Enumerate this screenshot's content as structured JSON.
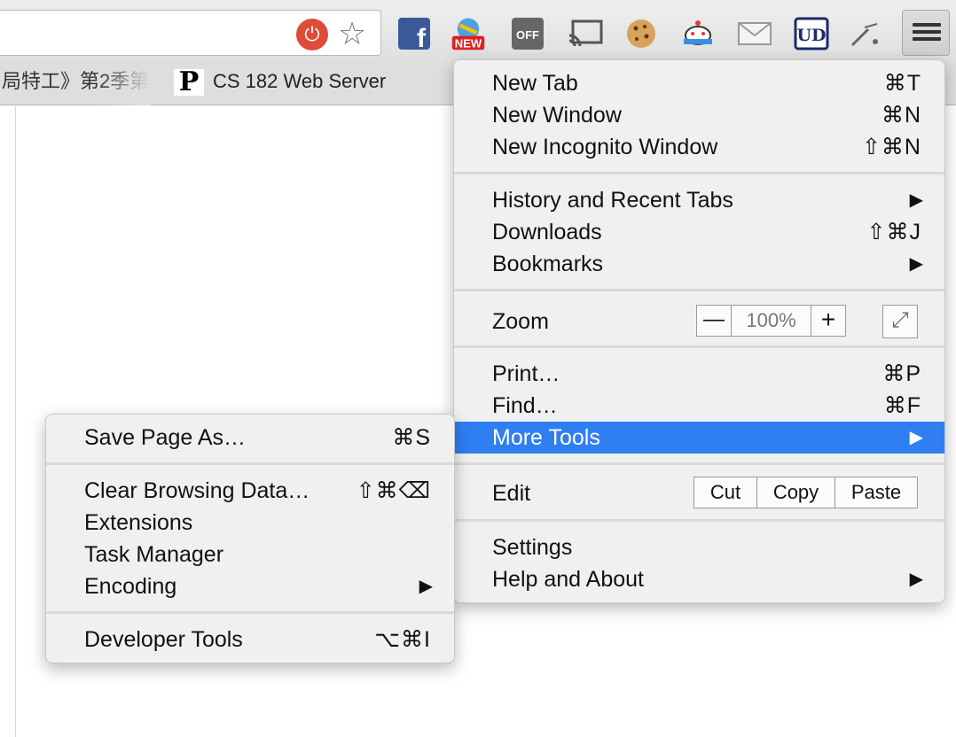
{
  "toolbar": {
    "extensions": [
      "plug-blocked-icon",
      "star-bookmark-icon",
      "facebook-icon",
      "new-extension-icon",
      "off-switch-icon",
      "cast-icon",
      "cookie-icon",
      "pixel-mascot-icon",
      "mail-icon",
      "ud-icon",
      "wand-icon",
      "hamburger-menu-icon"
    ],
    "new_badge": "NEW",
    "off_label": "OFF",
    "ud_label": "UD"
  },
  "bookmarks": {
    "item1": "局特工》第2季第",
    "item2": "CS 182 Web Server",
    "item2_icon_letter": "P"
  },
  "menu": {
    "new_tab": {
      "label": "New Tab",
      "shortcut": "⌘T"
    },
    "new_window": {
      "label": "New Window",
      "shortcut": "⌘N"
    },
    "new_incognito": {
      "label": "New Incognito Window",
      "shortcut": "⇧⌘N"
    },
    "history": {
      "label": "History and Recent Tabs",
      "arrow": "▶"
    },
    "downloads": {
      "label": "Downloads",
      "shortcut": "⇧⌘J"
    },
    "bookmarks": {
      "label": "Bookmarks",
      "arrow": "▶"
    },
    "zoom": {
      "label": "Zoom",
      "minus": "—",
      "value": "100%",
      "plus": "+",
      "fullscreen": "⤢"
    },
    "print": {
      "label": "Print…",
      "shortcut": "⌘P"
    },
    "find": {
      "label": "Find…",
      "shortcut": "⌘F"
    },
    "more_tools": {
      "label": "More Tools",
      "arrow": "▶"
    },
    "edit": {
      "label": "Edit",
      "cut": "Cut",
      "copy": "Copy",
      "paste": "Paste"
    },
    "settings": {
      "label": "Settings"
    },
    "help": {
      "label": "Help and About",
      "arrow": "▶"
    }
  },
  "submenu": {
    "save_page": {
      "label": "Save Page As…",
      "shortcut": "⌘S"
    },
    "clear_data": {
      "label": "Clear Browsing Data…",
      "shortcut": "⇧⌘⌫"
    },
    "extensions": {
      "label": "Extensions"
    },
    "task_manager": {
      "label": "Task Manager"
    },
    "encoding": {
      "label": "Encoding",
      "arrow": "▶"
    },
    "developer_tools": {
      "label": "Developer Tools",
      "shortcut": "⌥⌘I"
    }
  },
  "colors": {
    "highlight": "#2f7ef2",
    "menu_bg": "#f0f0f0",
    "plug_red": "#dd4b39",
    "facebook_blue": "#3b5998"
  }
}
